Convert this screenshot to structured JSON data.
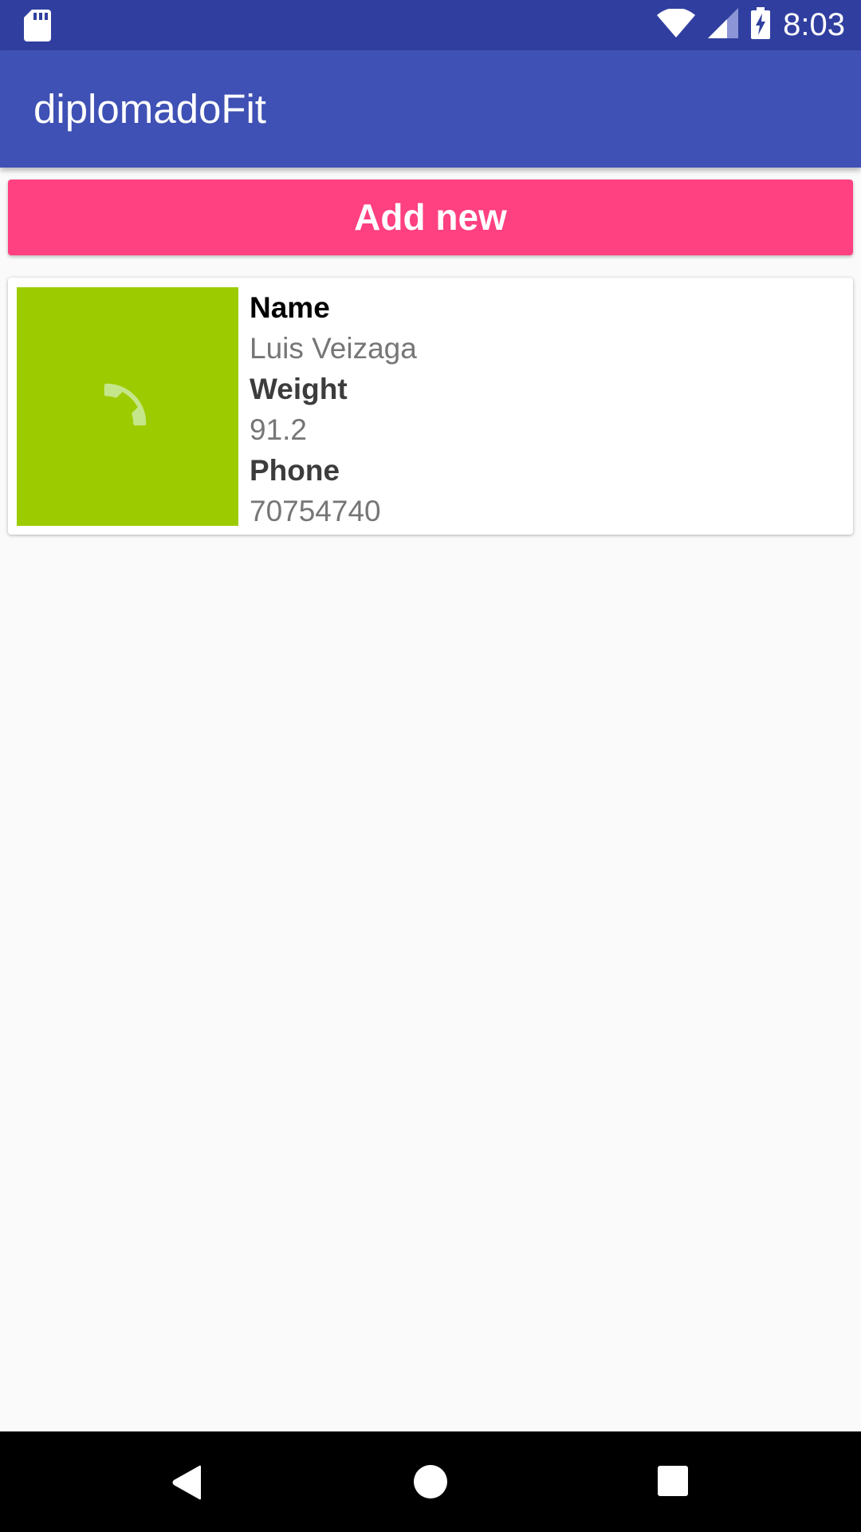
{
  "status_bar": {
    "time": "8:03",
    "icons": [
      "sd-card-icon",
      "wifi-icon",
      "cell-signal-icon",
      "battery-charging-icon"
    ]
  },
  "app_bar": {
    "title": "diplomadoFit",
    "background_color": "#3f51b5"
  },
  "actions": {
    "add_new_label": "Add new",
    "accent_color": "#ff4081"
  },
  "list": {
    "items": [
      {
        "image_icon": "phone-icon",
        "image_color": "#9ccc00",
        "name_label": "Name",
        "name_value": "Luis Veizaga",
        "weight_label": "Weight",
        "weight_value": "91.2",
        "phone_label": "Phone",
        "phone_value": "70754740"
      }
    ]
  },
  "nav_bar": {
    "icons": [
      "back-icon",
      "home-icon",
      "recents-icon"
    ]
  }
}
